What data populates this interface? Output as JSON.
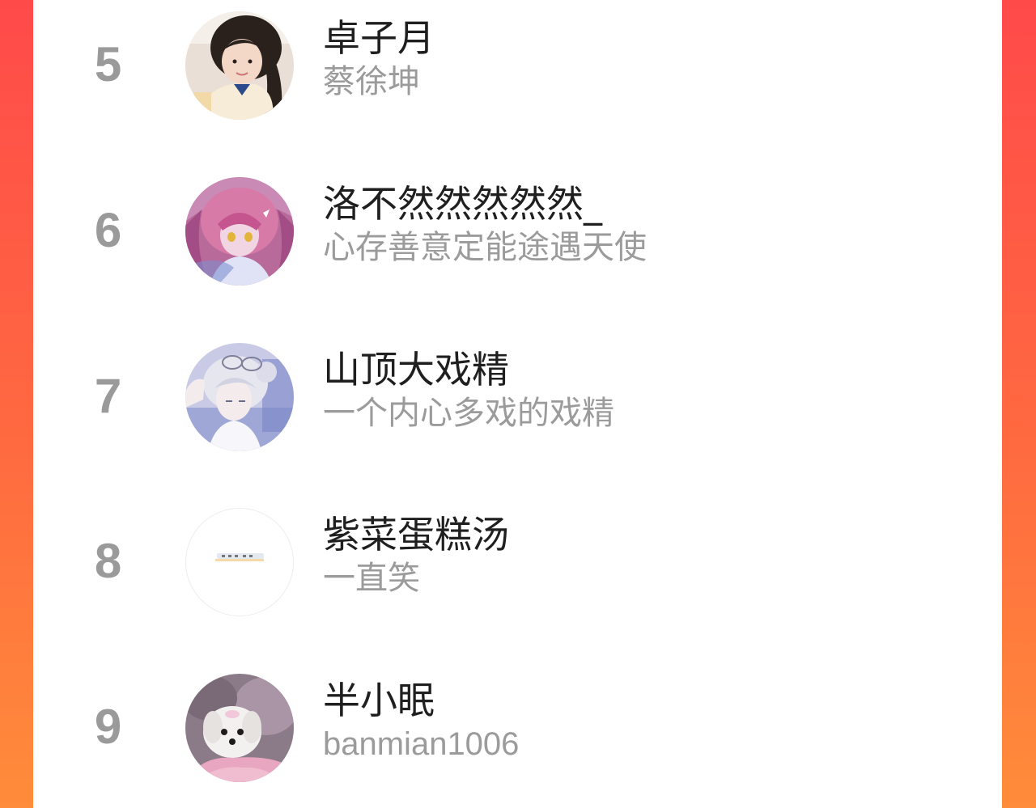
{
  "list": {
    "items": [
      {
        "rank": "5",
        "name": "卓子月",
        "subtitle": "蔡徐坤",
        "avatar": "girl-photo-avatar"
      },
      {
        "rank": "6",
        "name": "洛不然然然然然_",
        "subtitle": "心存善意定能途遇天使",
        "avatar": "anime-girl-avatar"
      },
      {
        "rank": "7",
        "name": "山顶大戏精",
        "subtitle": "一个内心多戏的戏精",
        "avatar": "anime-boy-avatar"
      },
      {
        "rank": "8",
        "name": "紫菜蛋糕汤",
        "subtitle": "一直笑",
        "avatar": "text-strip-avatar"
      },
      {
        "rank": "9",
        "name": "半小眠",
        "subtitle": "banmian1006",
        "avatar": "white-puppy-avatar"
      }
    ]
  },
  "colors": {
    "background_top": "#ff4a4a",
    "background_bottom": "#ff8c3a",
    "card": "#ffffff",
    "rank": "#9a9a9a",
    "name": "#1f1f1f",
    "subtitle": "#9b9b9b"
  }
}
